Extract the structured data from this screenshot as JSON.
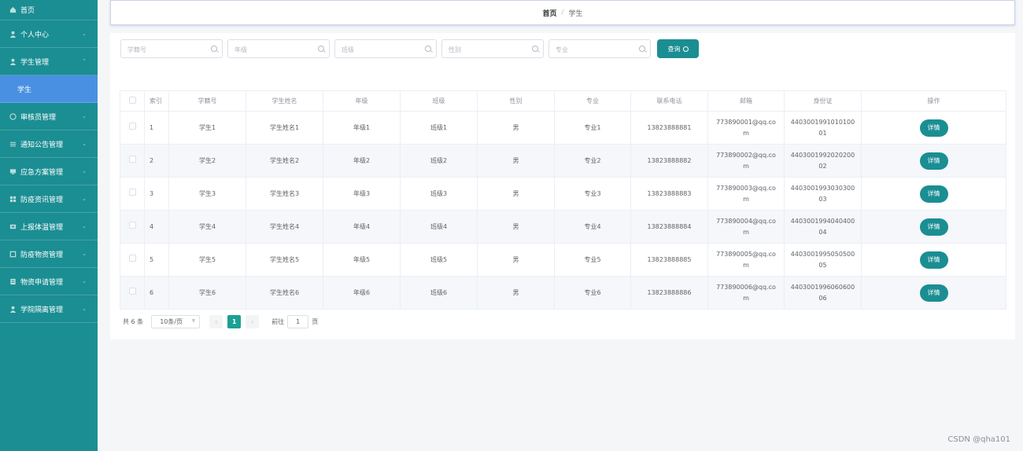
{
  "sidebar": {
    "items": [
      {
        "label": "首页",
        "icon": "home-icon",
        "arrow": ""
      },
      {
        "label": "个人中心",
        "icon": "user-icon",
        "arrow": "⌄"
      },
      {
        "label": "学生管理",
        "icon": "user-icon",
        "arrow": "⌃"
      },
      {
        "label": "学生",
        "icon": "",
        "arrow": ""
      },
      {
        "label": "审核员管理",
        "icon": "reviewer-icon",
        "arrow": "⌄"
      },
      {
        "label": "通知公告管理",
        "icon": "list-icon",
        "arrow": "⌄"
      },
      {
        "label": "应急方案管理",
        "icon": "monitor-icon",
        "arrow": "⌄"
      },
      {
        "label": "防疫资讯管理",
        "icon": "grid-icon",
        "arrow": "⌄"
      },
      {
        "label": "上报体温管理",
        "icon": "thermometer-icon",
        "arrow": "⌄"
      },
      {
        "label": "防疫物资管理",
        "icon": "box-icon",
        "arrow": "⌄"
      },
      {
        "label": "物资申请管理",
        "icon": "form-icon",
        "arrow": "⌄"
      },
      {
        "label": "学院隔离管理",
        "icon": "user-icon",
        "arrow": "⌄"
      }
    ]
  },
  "breadcrumb": {
    "home": "首页",
    "sep": "/",
    "current": "学生"
  },
  "search": {
    "fields": [
      {
        "placeholder": "学籍号"
      },
      {
        "placeholder": "年级"
      },
      {
        "placeholder": "班级"
      },
      {
        "placeholder": "性别"
      },
      {
        "placeholder": "专业"
      }
    ],
    "query_label": "查询"
  },
  "table": {
    "headers": {
      "index": "索引",
      "id": "学籍号",
      "name": "学生姓名",
      "grade": "年级",
      "class": "班级",
      "gender": "性别",
      "major": "专业",
      "phone": "联系电话",
      "email": "邮箱",
      "idcard": "身份证",
      "action": "操作"
    },
    "rows": [
      {
        "index": "1",
        "id": "学生1",
        "name": "学生姓名1",
        "grade": "年级1",
        "class": "班级1",
        "gender": "男",
        "major": "专业1",
        "phone": "13823888881",
        "email1": "773890001@qq.co",
        "email2": "m",
        "id1": "4403001991010100",
        "id2": "01",
        "action": "详情"
      },
      {
        "index": "2",
        "id": "学生2",
        "name": "学生姓名2",
        "grade": "年级2",
        "class": "班级2",
        "gender": "男",
        "major": "专业2",
        "phone": "13823888882",
        "email1": "773890002@qq.co",
        "email2": "m",
        "id1": "4403001992020200",
        "id2": "02",
        "action": "详情"
      },
      {
        "index": "3",
        "id": "学生3",
        "name": "学生姓名3",
        "grade": "年级3",
        "class": "班级3",
        "gender": "男",
        "major": "专业3",
        "phone": "13823888883",
        "email1": "773890003@qq.co",
        "email2": "m",
        "id1": "4403001993030300",
        "id2": "03",
        "action": "详情"
      },
      {
        "index": "4",
        "id": "学生4",
        "name": "学生姓名4",
        "grade": "年级4",
        "class": "班级4",
        "gender": "男",
        "major": "专业4",
        "phone": "13823888884",
        "email1": "773890004@qq.co",
        "email2": "m",
        "id1": "4403001994040400",
        "id2": "04",
        "action": "详情"
      },
      {
        "index": "5",
        "id": "学生5",
        "name": "学生姓名5",
        "grade": "年级5",
        "class": "班级5",
        "gender": "男",
        "major": "专业5",
        "phone": "13823888885",
        "email1": "773890005@qq.co",
        "email2": "m",
        "id1": "4403001995050500",
        "id2": "05",
        "action": "详情"
      },
      {
        "index": "6",
        "id": "学生6",
        "name": "学生姓名6",
        "grade": "年级6",
        "class": "班级6",
        "gender": "男",
        "major": "专业6",
        "phone": "13823888886",
        "email1": "773890006@qq.co",
        "email2": "m",
        "id1": "4403001996060600",
        "id2": "06",
        "action": "详情"
      }
    ]
  },
  "pagination": {
    "total": "共 6 条",
    "page_size": "10条/页",
    "current_page": "1",
    "goto_label": "前往",
    "goto_value": "1",
    "page_unit": "页"
  },
  "watermark": "CSDN @qha101",
  "colors": {
    "sidebar": "#1b8e93",
    "active": "#4a90e2",
    "accent": "#1b8e93",
    "page_active": "#1aa094"
  }
}
